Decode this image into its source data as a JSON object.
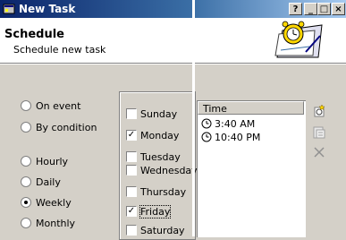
{
  "window": {
    "title": "New Task",
    "buttons": {
      "help": "?",
      "minimize": "_",
      "maximize": "□",
      "close": "×"
    }
  },
  "header": {
    "title": "Schedule",
    "subtitle": "Schedule new task",
    "art_icon": "alarm-clock-calendar-icon"
  },
  "triggers": [
    {
      "label": "On event",
      "selected": false
    },
    {
      "label": "By condition",
      "selected": false
    },
    {
      "label": "Hourly",
      "selected": false
    },
    {
      "label": "Daily",
      "selected": false
    },
    {
      "label": "Weekly",
      "selected": true
    },
    {
      "label": "Monthly",
      "selected": false
    }
  ],
  "days": [
    {
      "label": "Sunday",
      "checked": false
    },
    {
      "label": "Monday",
      "checked": true
    },
    {
      "label": "Tuesday",
      "checked": false
    },
    {
      "label": "Wednesday",
      "checked": false
    },
    {
      "label": "Thursday",
      "checked": false
    },
    {
      "label": "Friday",
      "checked": true
    },
    {
      "label": "Saturday",
      "checked": false
    }
  ],
  "times": {
    "column_header": "Time",
    "rows": [
      {
        "time": "3:40 AM"
      },
      {
        "time": "10:40 PM"
      }
    ]
  },
  "side_buttons": [
    "add-time-icon",
    "edit-time-icon",
    "delete-time-icon"
  ]
}
